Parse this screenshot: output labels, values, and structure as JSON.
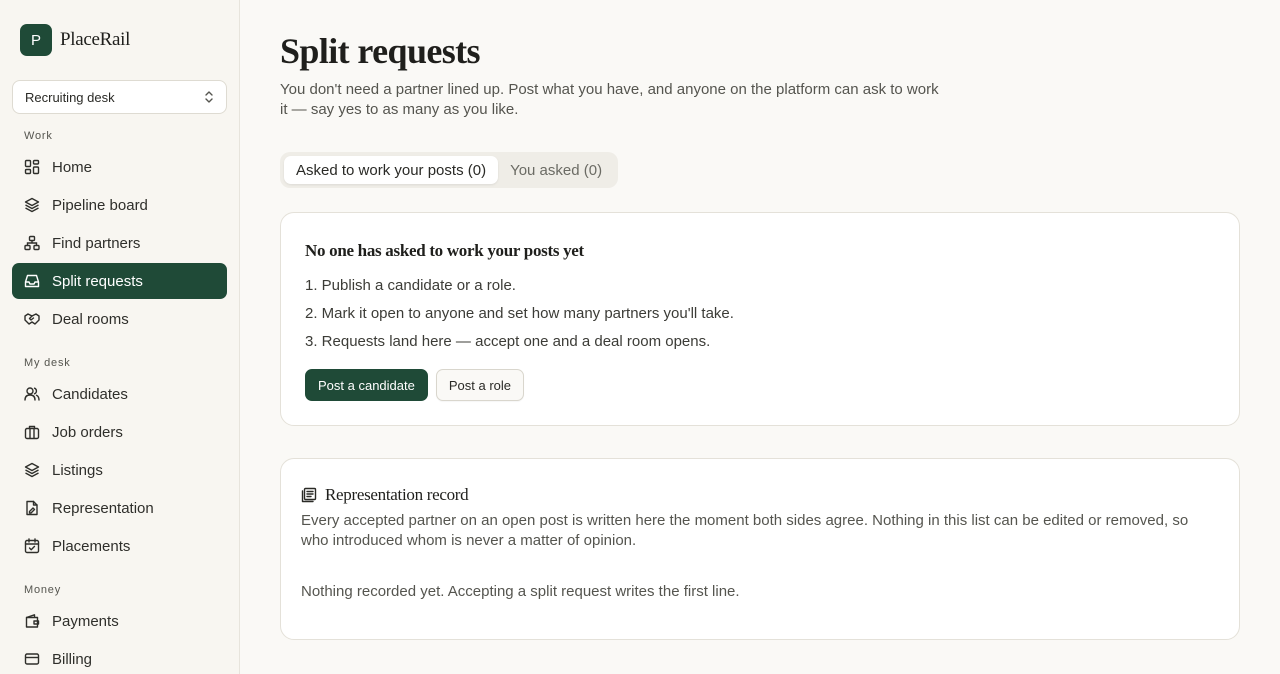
{
  "brand": {
    "initial": "P",
    "name": "PlaceRail"
  },
  "desk_selector": {
    "value": "Recruiting desk"
  },
  "sidebar": {
    "sections": [
      {
        "label": "Work",
        "items": [
          {
            "label": "Home",
            "icon": "grid-icon"
          },
          {
            "label": "Pipeline board",
            "icon": "layers-icon"
          },
          {
            "label": "Find partners",
            "icon": "network-icon"
          },
          {
            "label": "Split requests",
            "icon": "inbox-icon",
            "active": true
          },
          {
            "label": "Deal rooms",
            "icon": "handshake-icon"
          }
        ]
      },
      {
        "label": "My desk",
        "items": [
          {
            "label": "Candidates",
            "icon": "users-icon"
          },
          {
            "label": "Job orders",
            "icon": "briefcase-icon"
          },
          {
            "label": "Listings",
            "icon": "layers-icon"
          },
          {
            "label": "Representation",
            "icon": "document-pen-icon"
          },
          {
            "label": "Placements",
            "icon": "calendar-check-icon"
          }
        ]
      },
      {
        "label": "Money",
        "items": [
          {
            "label": "Payments",
            "icon": "wallet-icon"
          },
          {
            "label": "Billing",
            "icon": "card-icon"
          }
        ]
      }
    ]
  },
  "page": {
    "title": "Split requests",
    "subtitle": "You don't need a partner lined up. Post what you have, and anyone on the platform can ask to work it — say yes to as many as you like."
  },
  "tabs": [
    {
      "label": "Asked to work your posts (0)",
      "active": true
    },
    {
      "label": "You asked (0)",
      "active": false
    }
  ],
  "empty_card": {
    "title": "No one has asked to work your posts yet",
    "steps": [
      "1. Publish a candidate or a role.",
      "2. Mark it open to anyone and set how many partners you'll take.",
      "3. Requests land here — accept one and a deal room opens."
    ],
    "primary_button": "Post a candidate",
    "secondary_button": "Post a role"
  },
  "record_card": {
    "title": "Representation record",
    "icon": "ledger-icon",
    "description": "Every accepted partner on an open post is written here the moment both sides agree. Nothing in this list can be edited or removed, so who introduced whom is never a matter of opinion.",
    "empty_text": "Nothing recorded yet. Accepting a split request writes the first line."
  },
  "colors": {
    "accent": "#1f4a37",
    "background": "#faf9f6",
    "sidebar": "#f8f6f1"
  }
}
